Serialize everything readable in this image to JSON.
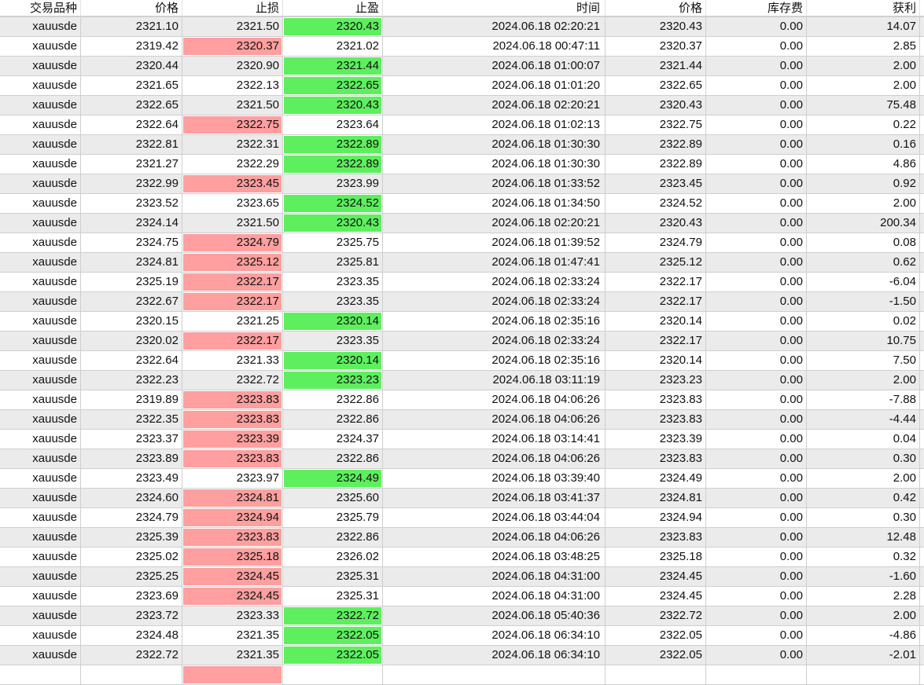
{
  "colors": {
    "stop_loss_hit": "#ff9f9f",
    "take_profit_hit": "#5eef5e",
    "row_alt": "#ebebeb"
  },
  "headers": [
    "交易品种",
    "价格",
    "止损",
    "止盈",
    "时间",
    "价格",
    "库存费",
    "获利"
  ],
  "rows": [
    {
      "cells": [
        "xauusde",
        "2321.10",
        "2321.50",
        "2320.43",
        "2024.06.18 02:20:21",
        "2320.43",
        "0.00",
        "14.07"
      ],
      "hit": "tp"
    },
    {
      "cells": [
        "xauusde",
        "2319.42",
        "2320.37",
        "2321.02",
        "2024.06.18 00:47:11",
        "2320.37",
        "0.00",
        "2.85"
      ],
      "hit": "sl"
    },
    {
      "cells": [
        "xauusde",
        "2320.44",
        "2320.90",
        "2321.44",
        "2024.06.18 01:00:07",
        "2321.44",
        "0.00",
        "2.00"
      ],
      "hit": "tp"
    },
    {
      "cells": [
        "xauusde",
        "2321.65",
        "2322.13",
        "2322.65",
        "2024.06.18 01:01:20",
        "2322.65",
        "0.00",
        "2.00"
      ],
      "hit": "tp"
    },
    {
      "cells": [
        "xauusde",
        "2322.65",
        "2321.50",
        "2320.43",
        "2024.06.18 02:20:21",
        "2320.43",
        "0.00",
        "75.48"
      ],
      "hit": "tp"
    },
    {
      "cells": [
        "xauusde",
        "2322.64",
        "2322.75",
        "2323.64",
        "2024.06.18 01:02:13",
        "2322.75",
        "0.00",
        "0.22"
      ],
      "hit": "sl"
    },
    {
      "cells": [
        "xauusde",
        "2322.81",
        "2322.31",
        "2322.89",
        "2024.06.18 01:30:30",
        "2322.89",
        "0.00",
        "0.16"
      ],
      "hit": "tp"
    },
    {
      "cells": [
        "xauusde",
        "2321.27",
        "2322.29",
        "2322.89",
        "2024.06.18 01:30:30",
        "2322.89",
        "0.00",
        "4.86"
      ],
      "hit": "tp"
    },
    {
      "cells": [
        "xauusde",
        "2322.99",
        "2323.45",
        "2323.99",
        "2024.06.18 01:33:52",
        "2323.45",
        "0.00",
        "0.92"
      ],
      "hit": "sl"
    },
    {
      "cells": [
        "xauusde",
        "2323.52",
        "2323.65",
        "2324.52",
        "2024.06.18 01:34:50",
        "2324.52",
        "0.00",
        "2.00"
      ],
      "hit": "tp"
    },
    {
      "cells": [
        "xauusde",
        "2324.14",
        "2321.50",
        "2320.43",
        "2024.06.18 02:20:21",
        "2320.43",
        "0.00",
        "200.34"
      ],
      "hit": "tp"
    },
    {
      "cells": [
        "xauusde",
        "2324.75",
        "2324.79",
        "2325.75",
        "2024.06.18 01:39:52",
        "2324.79",
        "0.00",
        "0.08"
      ],
      "hit": "sl"
    },
    {
      "cells": [
        "xauusde",
        "2324.81",
        "2325.12",
        "2325.81",
        "2024.06.18 01:47:41",
        "2325.12",
        "0.00",
        "0.62"
      ],
      "hit": "sl"
    },
    {
      "cells": [
        "xauusde",
        "2325.19",
        "2322.17",
        "2323.35",
        "2024.06.18 02:33:24",
        "2322.17",
        "0.00",
        "-6.04"
      ],
      "hit": "sl"
    },
    {
      "cells": [
        "xauusde",
        "2322.67",
        "2322.17",
        "2323.35",
        "2024.06.18 02:33:24",
        "2322.17",
        "0.00",
        "-1.50"
      ],
      "hit": "sl"
    },
    {
      "cells": [
        "xauusde",
        "2320.15",
        "2321.25",
        "2320.14",
        "2024.06.18 02:35:16",
        "2320.14",
        "0.00",
        "0.02"
      ],
      "hit": "tp"
    },
    {
      "cells": [
        "xauusde",
        "2320.02",
        "2322.17",
        "2323.35",
        "2024.06.18 02:33:24",
        "2322.17",
        "0.00",
        "10.75"
      ],
      "hit": "sl"
    },
    {
      "cells": [
        "xauusde",
        "2322.64",
        "2321.33",
        "2320.14",
        "2024.06.18 02:35:16",
        "2320.14",
        "0.00",
        "7.50"
      ],
      "hit": "tp"
    },
    {
      "cells": [
        "xauusde",
        "2322.23",
        "2322.72",
        "2323.23",
        "2024.06.18 03:11:19",
        "2323.23",
        "0.00",
        "2.00"
      ],
      "hit": "tp"
    },
    {
      "cells": [
        "xauusde",
        "2319.89",
        "2323.83",
        "2322.86",
        "2024.06.18 04:06:26",
        "2323.83",
        "0.00",
        "-7.88"
      ],
      "hit": "sl"
    },
    {
      "cells": [
        "xauusde",
        "2322.35",
        "2323.83",
        "2322.86",
        "2024.06.18 04:06:26",
        "2323.83",
        "0.00",
        "-4.44"
      ],
      "hit": "sl"
    },
    {
      "cells": [
        "xauusde",
        "2323.37",
        "2323.39",
        "2324.37",
        "2024.06.18 03:14:41",
        "2323.39",
        "0.00",
        "0.04"
      ],
      "hit": "sl"
    },
    {
      "cells": [
        "xauusde",
        "2323.89",
        "2323.83",
        "2322.86",
        "2024.06.18 04:06:26",
        "2323.83",
        "0.00",
        "0.30"
      ],
      "hit": "sl"
    },
    {
      "cells": [
        "xauusde",
        "2323.49",
        "2323.97",
        "2324.49",
        "2024.06.18 03:39:40",
        "2324.49",
        "0.00",
        "2.00"
      ],
      "hit": "tp"
    },
    {
      "cells": [
        "xauusde",
        "2324.60",
        "2324.81",
        "2325.60",
        "2024.06.18 03:41:37",
        "2324.81",
        "0.00",
        "0.42"
      ],
      "hit": "sl"
    },
    {
      "cells": [
        "xauusde",
        "2324.79",
        "2324.94",
        "2325.79",
        "2024.06.18 03:44:04",
        "2324.94",
        "0.00",
        "0.30"
      ],
      "hit": "sl"
    },
    {
      "cells": [
        "xauusde",
        "2325.39",
        "2323.83",
        "2322.86",
        "2024.06.18 04:06:26",
        "2323.83",
        "0.00",
        "12.48"
      ],
      "hit": "sl"
    },
    {
      "cells": [
        "xauusde",
        "2325.02",
        "2325.18",
        "2326.02",
        "2024.06.18 03:48:25",
        "2325.18",
        "0.00",
        "0.32"
      ],
      "hit": "sl"
    },
    {
      "cells": [
        "xauusde",
        "2325.25",
        "2324.45",
        "2325.31",
        "2024.06.18 04:31:00",
        "2324.45",
        "0.00",
        "-1.60"
      ],
      "hit": "sl"
    },
    {
      "cells": [
        "xauusde",
        "2323.69",
        "2324.45",
        "2325.31",
        "2024.06.18 04:31:00",
        "2324.45",
        "0.00",
        "2.28"
      ],
      "hit": "sl"
    },
    {
      "cells": [
        "xauusde",
        "2323.72",
        "2323.33",
        "2322.72",
        "2024.06.18 05:40:36",
        "2322.72",
        "0.00",
        "2.00"
      ],
      "hit": "tp"
    },
    {
      "cells": [
        "xauusde",
        "2324.48",
        "2321.35",
        "2322.05",
        "2024.06.18 06:34:10",
        "2322.05",
        "0.00",
        "-4.86"
      ],
      "hit": "tp"
    },
    {
      "cells": [
        "xauusde",
        "2322.72",
        "2321.35",
        "2322.05",
        "2024.06.18 06:34:10",
        "2322.05",
        "0.00",
        "-2.01"
      ],
      "hit": "tp"
    },
    {
      "cells": [
        "",
        "",
        "",
        "",
        "",
        "",
        "",
        ""
      ],
      "hit": "sl"
    }
  ]
}
